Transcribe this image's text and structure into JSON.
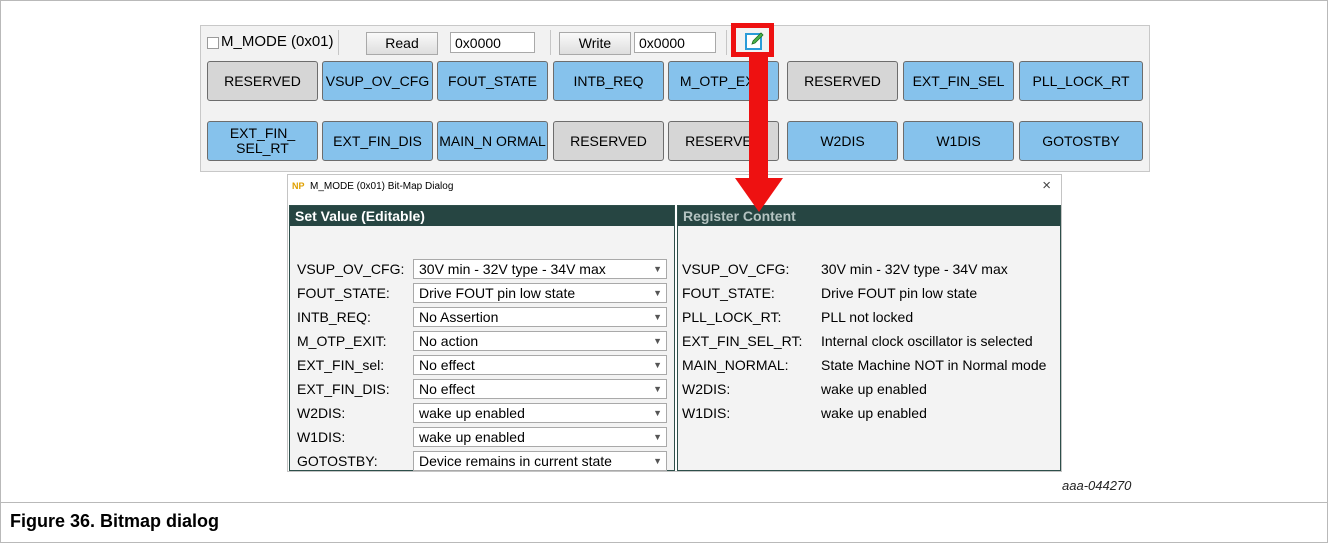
{
  "toolbar": {
    "register_name": "M_MODE (0x01)",
    "read_label": "Read",
    "read_value": "0x0000",
    "write_label": "Write",
    "write_value": "0x0000",
    "edit_icon": "edit-pencil-icon"
  },
  "bits_row1": [
    "RESERVED",
    "VSUP_OV_CFG",
    "FOUT_STATE",
    "INTB_REQ",
    "M_OTP_EXIT",
    "RESERVED",
    "EXT_FIN_SEL",
    "PLL_LOCK_RT"
  ],
  "bits_row2": [
    "EXT_FIN_ SEL_RT",
    "EXT_FIN_DIS",
    "MAIN_N ORMAL",
    "RESERVED",
    "RESERVED",
    "W2DIS",
    "W1DIS",
    "GOTOSTBY"
  ],
  "colors": {
    "bit_blue": "#86c2ec",
    "bit_grey": "#d6d6d6",
    "panel_header": "#264542",
    "callout_red": "#ee1111"
  },
  "dialog": {
    "title": "M_MODE (0x01) Bit-Map Dialog",
    "close": "×",
    "set_value": {
      "header": "Set Value (Editable)",
      "rows": [
        {
          "label": "VSUP_OV_CFG:",
          "value": "30V min - 32V type - 34V max"
        },
        {
          "label": "FOUT_STATE:",
          "value": "Drive FOUT pin low state"
        },
        {
          "label": "INTB_REQ:",
          "value": "No Assertion"
        },
        {
          "label": "M_OTP_EXIT:",
          "value": "No action"
        },
        {
          "label": "EXT_FIN_sel:",
          "value": "No effect"
        },
        {
          "label": "EXT_FIN_DIS:",
          "value": "No effect"
        },
        {
          "label": "W2DIS:",
          "value": "wake up enabled"
        },
        {
          "label": "W1DIS:",
          "value": "wake up enabled"
        },
        {
          "label": "GOTOSTBY:",
          "value": "Device remains in current state"
        }
      ]
    },
    "register_content": {
      "header": "Register Content",
      "rows": [
        {
          "label": "VSUP_OV_CFG:",
          "value": "30V min - 32V type - 34V max"
        },
        {
          "label": "FOUT_STATE:",
          "value": "Drive FOUT pin low state"
        },
        {
          "label": "PLL_LOCK_RT:",
          "value": "PLL not locked"
        },
        {
          "label": "EXT_FIN_SEL_RT:",
          "value": "Internal clock oscillator is selected"
        },
        {
          "label": "MAIN_NORMAL:",
          "value": "State Machine NOT in Normal mode"
        },
        {
          "label": "W2DIS:",
          "value": "wake up enabled"
        },
        {
          "label": "W1DIS:",
          "value": "wake up enabled"
        }
      ]
    }
  },
  "figure_code": "aaa-044270",
  "caption": "Figure 36.  Bitmap dialog"
}
